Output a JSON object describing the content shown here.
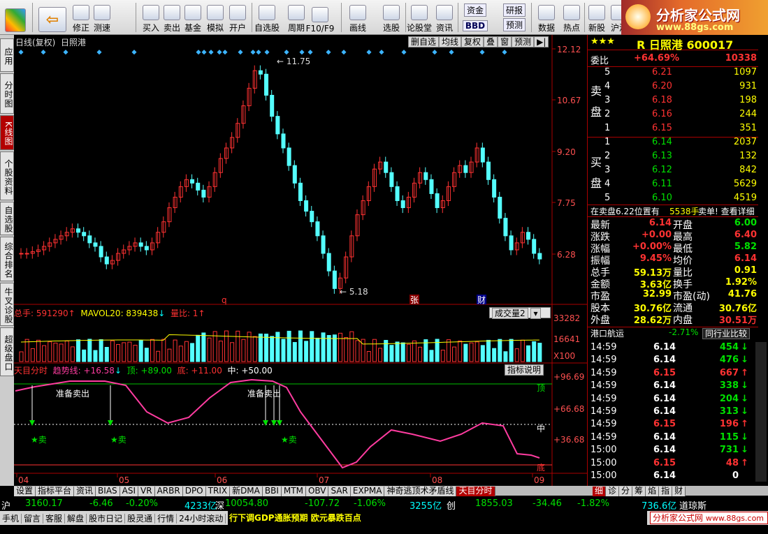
{
  "toolbar": {
    "items": [
      {
        "label": "修正",
        "icon": "arrow-up-icon"
      },
      {
        "label": "测速",
        "icon": "refresh-icon"
      },
      {
        "label": "买入",
        "icon": "buy-icon"
      },
      {
        "label": "卖出",
        "icon": "sell-icon"
      },
      {
        "label": "基金",
        "icon": "fund-icon"
      },
      {
        "label": "模拟",
        "icon": "hammer-icon"
      },
      {
        "label": "开户",
        "icon": "lock-icon"
      },
      {
        "label": "自选股",
        "icon": "star-icon"
      },
      {
        "label": "周期",
        "icon": "clock-icon"
      },
      {
        "label": "F10/F9",
        "icon": "f10-icon"
      },
      {
        "label": "画线",
        "icon": "pen-icon"
      },
      {
        "label": "选股",
        "icon": "screen-icon"
      },
      {
        "label": "论股堂",
        "icon": "lun-icon"
      },
      {
        "label": "资讯",
        "icon": "info-icon"
      },
      {
        "label": "数据",
        "icon": "pe-icon"
      },
      {
        "label": "热点",
        "icon": "fire-icon"
      },
      {
        "label": "新股",
        "icon": "new-icon"
      },
      {
        "label": "沪港",
        "icon": "hk-icon"
      }
    ],
    "extra": {
      "zijin": "资金",
      "yanbao": "研报",
      "bbd": "BBD",
      "yuce": "预测",
      "icon_f": "F"
    },
    "back_icon": "back-arrow-icon"
  },
  "logo": {
    "title": "分析家公式网",
    "url": "www.88gs.com"
  },
  "left_tabs": [
    "应用",
    "分时图",
    "K线图",
    "个股资料",
    "自选股",
    "综合排名",
    "牛叉诊股",
    "超级盘口"
  ],
  "chart_header": {
    "title": "日线(复权)",
    "stock": "日照港",
    "buttons": [
      "删自选",
      "均线",
      "复权",
      "叠",
      "窗",
      "预测"
    ],
    "more": "▶|"
  },
  "price_axis": [
    "12.12",
    "10.67",
    "9.20",
    "7.75",
    "6.28"
  ],
  "price_labels": {
    "high": "11.75",
    "low": "5.18"
  },
  "markers": {
    "q": "q",
    "zhang": "张",
    "cai": "财"
  },
  "vol_header": {
    "total": "总手: 591290",
    "mavol": "MAVOL20: 839438",
    "liangbi": "量比: 1",
    "select": "成交量2"
  },
  "vol_axis": [
    "33282",
    "16641",
    "X100"
  ],
  "ind_header": {
    "name": "天目分时",
    "trend": "趋势线: +16.58",
    "top": "顶: +89.00",
    "bottom": "底: +11.00",
    "mid": "中: +50.00",
    "explain": "指标说明"
  },
  "ind_axis": [
    "+96.69",
    "+66.68",
    "+36.68"
  ],
  "ind_labels": {
    "top": "顶",
    "mid": "中",
    "bottom": "底",
    "sell_ready": "准备卖出",
    "sell": "★卖"
  },
  "date_axis": [
    "04",
    "05",
    "06",
    "07",
    "08",
    "09"
  ],
  "quote": {
    "stars": "★★★",
    "code_line": "R 日照港 600017",
    "weibi_label": "委比",
    "weibi": "+64.69%",
    "weicha": "10338",
    "sell_label": "卖盘",
    "buy_label": "买盘",
    "asks": [
      {
        "lv": "5",
        "p": "6.21",
        "v": "1097"
      },
      {
        "lv": "4",
        "p": "6.20",
        "v": "931"
      },
      {
        "lv": "3",
        "p": "6.18",
        "v": "198"
      },
      {
        "lv": "2",
        "p": "6.16",
        "v": "244"
      },
      {
        "lv": "1",
        "p": "6.15",
        "v": "351"
      }
    ],
    "bids": [
      {
        "lv": "1",
        "p": "6.14",
        "v": "2037"
      },
      {
        "lv": "2",
        "p": "6.13",
        "v": "132"
      },
      {
        "lv": "3",
        "p": "6.12",
        "v": "842"
      },
      {
        "lv": "4",
        "p": "6.11",
        "v": "5629"
      },
      {
        "lv": "5",
        "p": "6.10",
        "v": "4519"
      }
    ],
    "notice": "在卖盘6.22位置有",
    "notice_vol": "5538手",
    "notice_act": "卖单! 查看详细",
    "stats": [
      [
        "最新",
        "6.14",
        "开盘",
        "6.00"
      ],
      [
        "涨跌",
        "+0.00",
        "最高",
        "6.40"
      ],
      [
        "涨幅",
        "+0.00%",
        "最低",
        "5.82"
      ],
      [
        "振幅",
        "9.45%",
        "均价",
        "6.14"
      ],
      [
        "总手",
        "59.13万",
        "量比",
        "0.91"
      ],
      [
        "金额",
        "3.63亿",
        "换手",
        "1.92%"
      ],
      [
        "市盈",
        "32.99",
        "市盈(动)",
        "41.76"
      ],
      [
        "股本",
        "30.76亿",
        "流通",
        "30.76亿"
      ],
      [
        "外盘",
        "28.62万",
        "内盘",
        "30.51万"
      ]
    ],
    "industry": "港口航运",
    "industry_chg": "-2.71%",
    "compare": "同行业比较",
    "ticks": [
      [
        "14:59",
        "6.14",
        "454",
        "dn"
      ],
      [
        "14:59",
        "6.14",
        "476",
        "dn"
      ],
      [
        "14:59",
        "6.15",
        "667",
        "up"
      ],
      [
        "14:59",
        "6.14",
        "338",
        "dn"
      ],
      [
        "14:59",
        "6.14",
        "204",
        "dn"
      ],
      [
        "14:59",
        "6.14",
        "313",
        "dn"
      ],
      [
        "14:59",
        "6.15",
        "196",
        "up"
      ],
      [
        "14:59",
        "6.14",
        "115",
        "dn"
      ],
      [
        "15:00",
        "6.14",
        "731",
        "dn"
      ],
      [
        "15:00",
        "6.15",
        "48",
        "up"
      ],
      [
        "15:00",
        "6.14",
        "0",
        ""
      ]
    ]
  },
  "right_tabs": [
    "细",
    "诊",
    "分",
    "筹",
    "焰",
    "指",
    "财"
  ],
  "bottom_tabs": [
    "设置",
    "指标平台",
    "资讯",
    "BIAS",
    "ASI",
    "VR",
    "ARBR",
    "DPO",
    "TRIX",
    "新DMA",
    "BBI",
    "MTM",
    "OBV",
    "SAR",
    "EXPMA",
    "神奇逃顶术矛盾线",
    "天目分时"
  ],
  "index_bar": {
    "sh": "沪",
    "sh_v": "3160.17",
    "sh_c": "-6.46",
    "sh_p": "-0.20%",
    "sh_a": "4233亿",
    "sz": "深",
    "sz_v": "10054.80",
    "sz_c": "-107.72",
    "sz_p": "-1.06%",
    "sz_a": "3255亿",
    "cy": "创",
    "cy_v": "1855.03",
    "cy_c": "-34.46",
    "cy_p": "-1.82%",
    "cy_a": "736.6亿",
    "dj": "道琼斯"
  },
  "status": {
    "items": [
      "手机",
      "留言",
      "客服",
      "解盘",
      "股市日记",
      "股灵通",
      "行情",
      "24小时滚动"
    ],
    "ticker": "行下调GDP通胀预期 欧元暴跌百点",
    "site": "分析家公式网",
    "site_url": "www.88gs.com"
  },
  "colors": {
    "up": "#ff3232",
    "down": "#54ffff",
    "ma": "#ffff00",
    "ind": "#ff3ca0"
  }
}
